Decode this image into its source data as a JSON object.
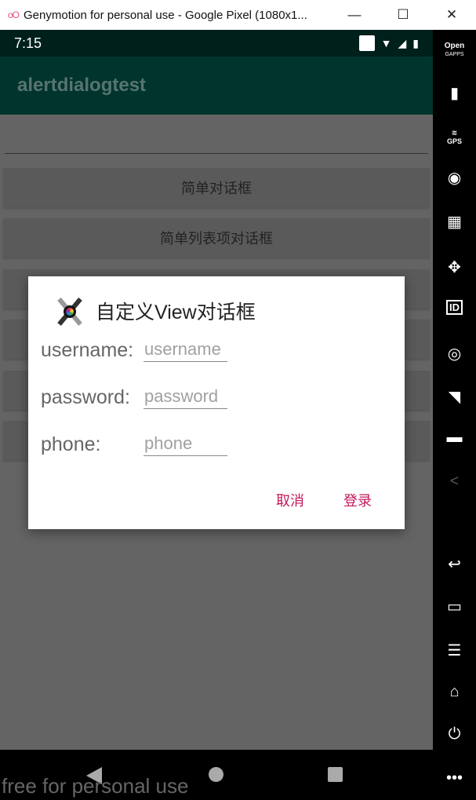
{
  "window": {
    "title": "Genymotion for personal use - Google Pixel (1080x1...",
    "logo": "oO",
    "minimize": "—",
    "maximize": "☐",
    "close": "✕"
  },
  "status": {
    "time": "7:15"
  },
  "app": {
    "title": "alertdialogtest"
  },
  "buttons": [
    {
      "label": "简单对话框"
    },
    {
      "label": "简单列表项对话框"
    },
    {
      "label": ""
    },
    {
      "label": ""
    },
    {
      "label": ""
    },
    {
      "label": ""
    }
  ],
  "dialog": {
    "title": "自定义View对话框",
    "icon": "tools-icon",
    "fields": [
      {
        "label": "username:",
        "placeholder": "username",
        "value": ""
      },
      {
        "label": "password:",
        "placeholder": "password",
        "value": ""
      },
      {
        "label": "phone:",
        "placeholder": "phone",
        "value": ""
      }
    ],
    "cancel": "取消",
    "login": "登录",
    "accent": "#c2185b"
  },
  "sidebar": {
    "gapps_top": "Open",
    "gapps_bottom": "GAPPS",
    "gps": "GPS",
    "id": "ID"
  },
  "watermark": "free for personal use"
}
